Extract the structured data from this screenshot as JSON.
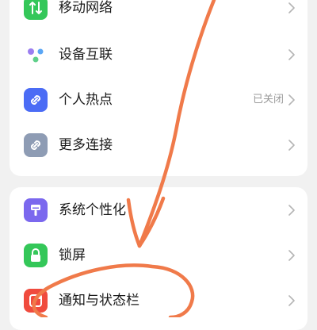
{
  "connections": {
    "items": [
      {
        "label": "移动网络",
        "value": "",
        "icon": "mobile-network-icon",
        "color": "#34c759"
      },
      {
        "label": "设备互联",
        "value": "",
        "icon": "device-connection-icon",
        "color": "#ffffff"
      },
      {
        "label": "个人热点",
        "value": "已关闭",
        "icon": "hotspot-icon",
        "color": "#4b6cf5"
      },
      {
        "label": "更多连接",
        "value": "",
        "icon": "more-connections-icon",
        "color": "#8e9cb4"
      }
    ]
  },
  "display": {
    "items": [
      {
        "label": "系统个性化",
        "value": "",
        "icon": "personalization-icon",
        "color": "#7b68ee"
      },
      {
        "label": "锁屏",
        "value": "",
        "icon": "lock-icon",
        "color": "#34c759"
      },
      {
        "label": "通知与状态栏",
        "value": "",
        "icon": "notification-icon",
        "color": "#f04b3e"
      }
    ]
  },
  "annotation": {
    "color": "#f07a4a"
  }
}
